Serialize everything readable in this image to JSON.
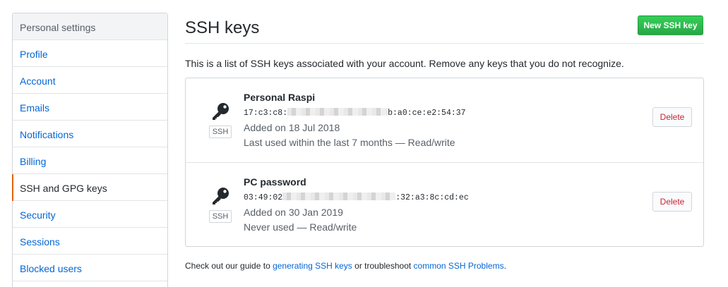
{
  "sidebar": {
    "heading": "Personal settings",
    "items": [
      {
        "label": "Profile"
      },
      {
        "label": "Account"
      },
      {
        "label": "Emails"
      },
      {
        "label": "Notifications"
      },
      {
        "label": "Billing"
      },
      {
        "label": "SSH and GPG keys",
        "selected": true
      },
      {
        "label": "Security"
      },
      {
        "label": "Sessions"
      },
      {
        "label": "Blocked users"
      }
    ]
  },
  "main": {
    "title": "SSH keys",
    "new_key_label": "New SSH key",
    "intro": "This is a list of SSH keys associated with your account. Remove any keys that you do not recognize.",
    "keys": [
      {
        "title": "Personal Raspi",
        "fingerprint_start": "17:c3:c8:",
        "fingerprint_end": "b:a0:ce:e2:54:37",
        "added": "Added on 18 Jul 2018",
        "usage": "Last used within the last 7 months — Read/write",
        "badge": "SSH",
        "delete_label": "Delete"
      },
      {
        "title": "PC password",
        "fingerprint_start": "03:49:02",
        "fingerprint_end": ":32:a3:8c:cd:ec",
        "added": "Added on 30 Jan 2019",
        "usage": "Never used — Read/write",
        "badge": "SSH",
        "delete_label": "Delete"
      }
    ],
    "footer": {
      "prefix": "Check out our guide to ",
      "link1": "generating SSH keys",
      "middle": " or troubleshoot ",
      "link2": "common SSH Problems",
      "suffix": "."
    }
  },
  "colors": {
    "link": "#0366d6",
    "accent_selected": "#e36209",
    "primary_button": "#28a745",
    "danger": "#cb2431"
  },
  "icons": [
    "key-icon"
  ]
}
